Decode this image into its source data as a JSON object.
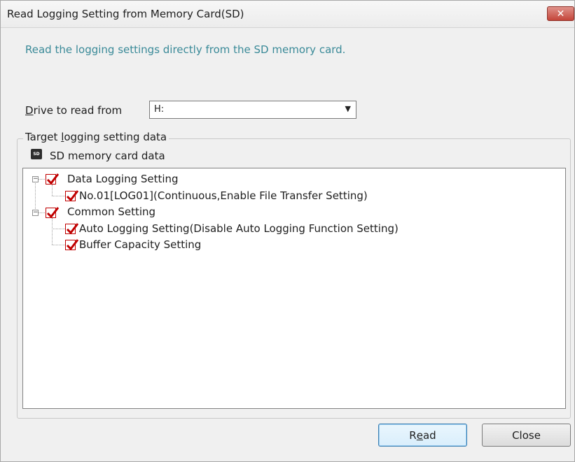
{
  "window": {
    "title": "Read Logging Setting from Memory Card(SD)",
    "close_glyph": "✕"
  },
  "description": "Read the logging settings directly from the SD memory card.",
  "drive": {
    "label_accel": "D",
    "label_rest": "rive to read from",
    "value": "H:"
  },
  "target_group": {
    "legend_pre": "Target ",
    "legend_accel": "l",
    "legend_post": "ogging setting data",
    "sd_icon_text": "SD",
    "sd_label": "SD memory card data"
  },
  "tree": {
    "nodes": [
      {
        "label": "Data Logging Setting",
        "checked": true,
        "expanded": true
      },
      {
        "label": "No.01[LOG01](Continuous,Enable File Transfer Setting)",
        "checked": true
      },
      {
        "label": "Common Setting",
        "checked": true,
        "expanded": true
      },
      {
        "label": "Auto Logging Setting(Disable Auto Logging Function Setting)",
        "checked": true
      },
      {
        "label": "Buffer Capacity Setting",
        "checked": true
      }
    ]
  },
  "buttons": {
    "read_pre": "R",
    "read_accel": "e",
    "read_post": "ad",
    "close": "Close"
  },
  "colors": {
    "accent_text": "#3a8a98",
    "check_color": "#c00000"
  }
}
